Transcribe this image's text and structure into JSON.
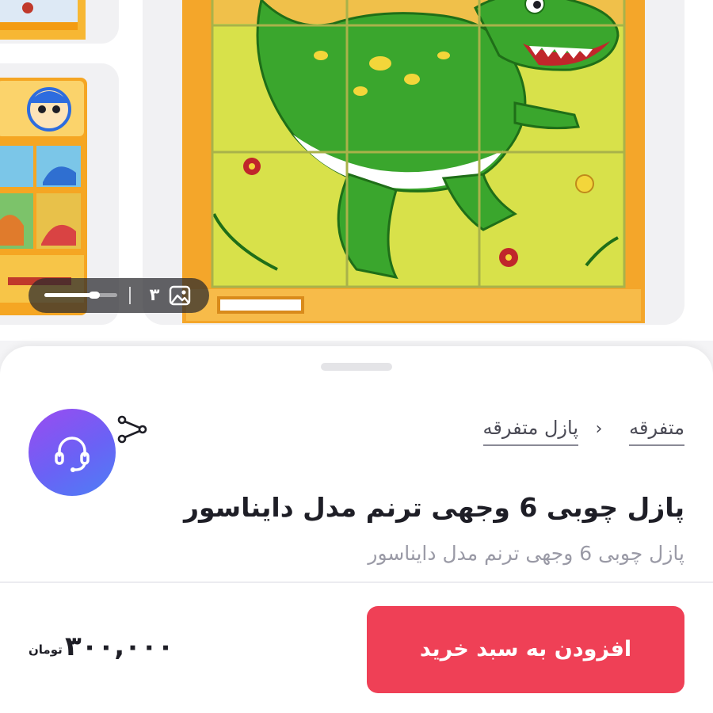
{
  "gallery": {
    "image_count": "۳",
    "carousel_progress": 0.72,
    "counter_icon": "image-icon"
  },
  "breadcrumb": {
    "items": [
      "متفرقه",
      "پازل متفرقه"
    ],
    "separator": "›"
  },
  "product": {
    "title": "پازل چوبی 6 وجهی ترنم مدل دایناسور",
    "subtitle": "پازل چوبی 6 وجهی ترنم مدل دایناسور"
  },
  "actions": {
    "support_icon": "headset-icon",
    "share_icon": "share-icon",
    "add_to_cart_label": "افزودن به سبد خرید"
  },
  "price": {
    "amount": "۳۰۰,۰۰۰",
    "currency": "تومان"
  },
  "colors": {
    "primary": "#ef4056",
    "support_gradient_start": "#9b4bf0",
    "support_gradient_end": "#4d7ff5"
  }
}
